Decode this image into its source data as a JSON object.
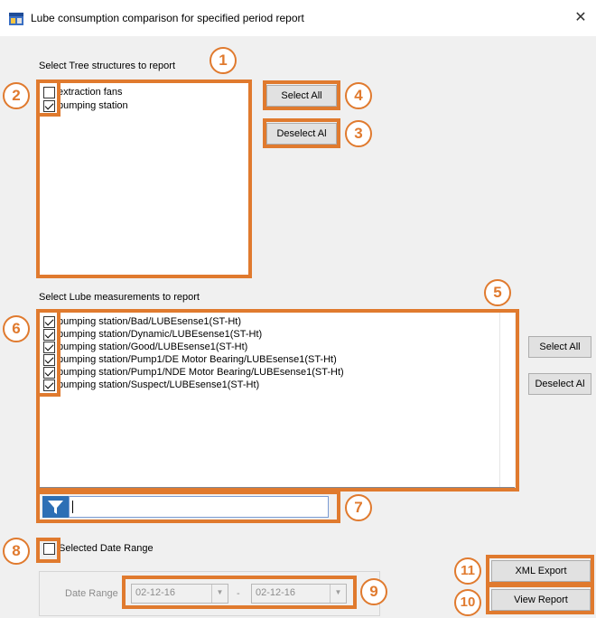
{
  "window": {
    "title": "Lube consumption comparison for specified period report",
    "close_glyph": "✕"
  },
  "tree_section": {
    "label": "Select Tree structures to report",
    "items": [
      {
        "label": "extraction fans",
        "checked": false
      },
      {
        "label": "pumping station",
        "checked": true
      }
    ],
    "select_all_label": "Select All",
    "deselect_all_label": "Deselect Al"
  },
  "lube_section": {
    "label": "Select Lube measurements to report",
    "items": [
      {
        "label": "pumping station/Bad/LUBEsense1(ST-Ht)",
        "checked": true
      },
      {
        "label": "pumping station/Dynamic/LUBEsense1(ST-Ht)",
        "checked": true
      },
      {
        "label": "pumping station/Good/LUBEsense1(ST-Ht)",
        "checked": true
      },
      {
        "label": "pumping station/Pump1/DE Motor Bearing/LUBEsense1(ST-Ht)",
        "checked": true
      },
      {
        "label": "pumping station/Pump1/NDE Motor Bearing/LUBEsense1(ST-Ht)",
        "checked": true
      },
      {
        "label": "pumping station/Suspect/LUBEsense1(ST-Ht)",
        "checked": true
      }
    ],
    "select_all_label": "Select All",
    "deselect_all_label": "Deselect Al"
  },
  "filter": {
    "icon": "filter-icon",
    "value": ""
  },
  "date": {
    "checkbox_label": "Selected Date Range",
    "checked": false,
    "range_label": "Date Range",
    "from": "02-12-16",
    "to": "02-12-16",
    "separator": "-"
  },
  "actions": {
    "xml_export_label": "XML Export",
    "view_report_label": "View Report"
  },
  "callouts": [
    "1",
    "2",
    "3",
    "4",
    "5",
    "6",
    "7",
    "8",
    "9",
    "10",
    "11"
  ],
  "colors": {
    "highlight": "#e07a2e",
    "button_face": "#e1e1e1",
    "filter_icon": "#2d6fb5"
  }
}
